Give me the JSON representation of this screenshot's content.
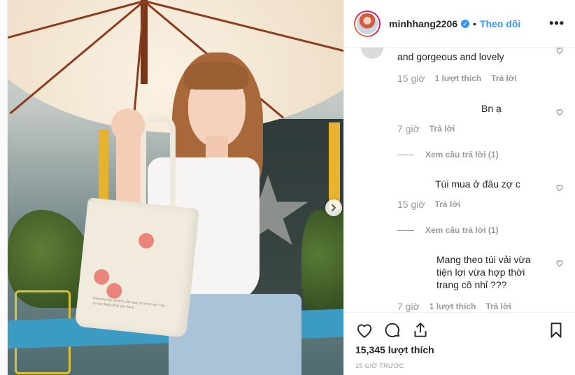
{
  "post": {
    "username": "minhhang2206",
    "verified_mark": "✓",
    "separator": "•",
    "follow_label": "Theo dõi",
    "more_label": "•••",
    "photo": {
      "bag_print": "Pleasing the world is the way of tomorrow. You do not think what you have."
    }
  },
  "comments": [
    {
      "text": "and gorgeous and lovely",
      "time": "15 giờ",
      "likes": "1 lượt thích",
      "reply": "Trả lời"
    },
    {
      "text": "Bn ạ",
      "time": "7 giờ",
      "reply": "Trả lời",
      "view_replies": "Xem câu trả lời (1)"
    },
    {
      "text": "Túi mua ở đâu zợ c",
      "time": "15 giờ",
      "reply": "Trả lời",
      "view_replies": "Xem câu trả lời (1)"
    },
    {
      "text": "Mang theo túi vải vừa tiện lợi vừa hợp thời trang cô nhỉ ???",
      "time": "7 giờ",
      "likes": "1 lượt thích",
      "reply": "Trả lời"
    }
  ],
  "footer": {
    "likes": "15,345 lượt thích",
    "date": "15 GIỜ TRƯỚC"
  },
  "colors": {
    "accent": "#3897f0",
    "text": "#262626",
    "muted": "#999999"
  },
  "icons": [
    "verified-icon",
    "more-icon",
    "heart-icon",
    "comment-icon",
    "share-icon",
    "bookmark-icon",
    "next-arrow-icon"
  ]
}
